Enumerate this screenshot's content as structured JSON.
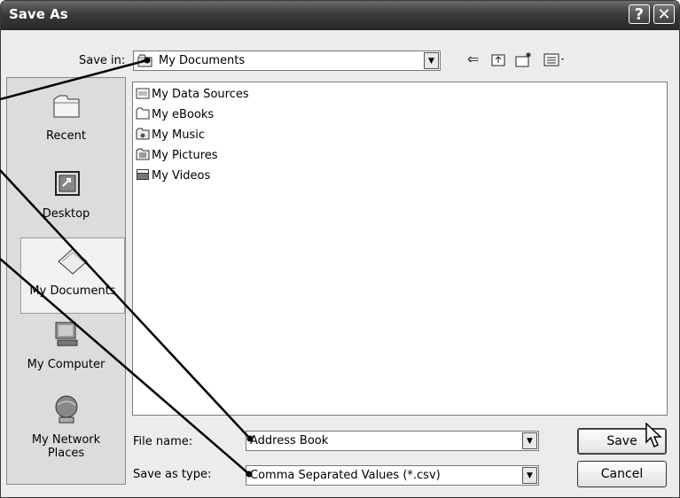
{
  "window": {
    "title": "Save As"
  },
  "titlebar": {
    "help": "?",
    "close": "✕"
  },
  "save_in": {
    "label": "Save in:",
    "value": "My Documents"
  },
  "places": [
    {
      "label": "Recent",
      "icon": "recent-folder-icon"
    },
    {
      "label": "Desktop",
      "icon": "desktop-icon"
    },
    {
      "label": "My Documents",
      "icon": "my-documents-icon"
    },
    {
      "label": "My Computer",
      "icon": "my-computer-icon"
    },
    {
      "label": "My Network Places",
      "icon": "network-places-icon"
    }
  ],
  "files": [
    {
      "name": "My Data Sources",
      "icon": "data-sources-icon"
    },
    {
      "name": "My eBooks",
      "icon": "folder-icon"
    },
    {
      "name": "My Music",
      "icon": "music-folder-icon"
    },
    {
      "name": "My Pictures",
      "icon": "pictures-folder-icon"
    },
    {
      "name": "My Videos",
      "icon": "videos-folder-icon"
    }
  ],
  "file_name": {
    "label": "File name:",
    "value": "Address Book"
  },
  "save_as_type": {
    "label": "Save as type:",
    "value": "Comma Separated Values (*.csv)"
  },
  "buttons": {
    "save": "Save",
    "cancel": "Cancel"
  },
  "toolbar": {
    "back_icon": "back-arrow-icon",
    "up_icon": "up-one-level-icon",
    "new_folder_icon": "new-folder-icon",
    "views_icon": "views-menu-icon"
  }
}
